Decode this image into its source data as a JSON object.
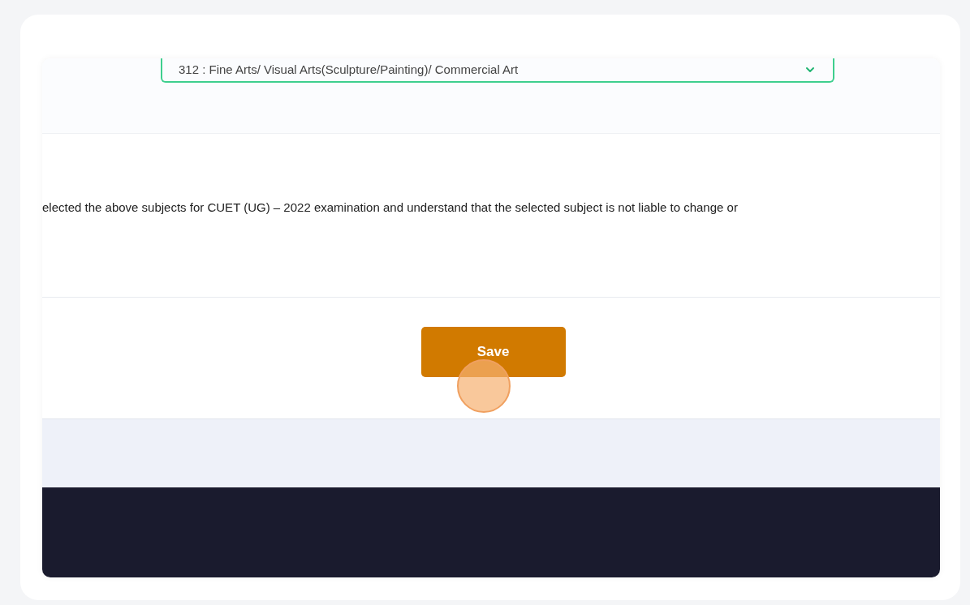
{
  "subject_select": {
    "value": "312 : Fine Arts/ Visual Arts(Sculpture/Painting)/ Commercial Art"
  },
  "declaration": "elected the above subjects for CUET (UG) – 2022 examination and understand that the selected subject is not liable to change or",
  "save_button": {
    "label": "Save"
  }
}
